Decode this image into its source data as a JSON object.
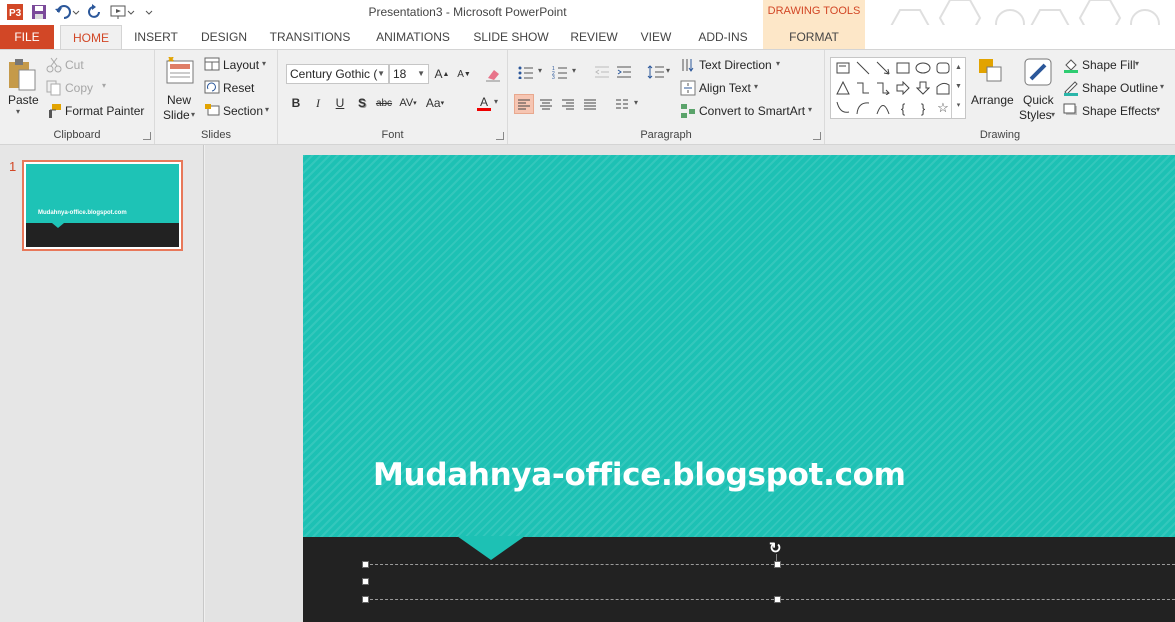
{
  "window": {
    "title": "Presentation3 - Microsoft PowerPoint"
  },
  "contextual": {
    "title": "DRAWING TOOLS",
    "tab": "FORMAT"
  },
  "tabs": [
    "FILE",
    "HOME",
    "INSERT",
    "DESIGN",
    "TRANSITIONS",
    "ANIMATIONS",
    "SLIDE SHOW",
    "REVIEW",
    "VIEW",
    "ADD-INS"
  ],
  "clipboard": {
    "paste": "Paste",
    "cut": "Cut",
    "copy": "Copy",
    "format_painter": "Format Painter",
    "label": "Clipboard"
  },
  "slides_group": {
    "new_slide_1": "New",
    "new_slide_2": "Slide",
    "layout": "Layout",
    "reset": "Reset",
    "section": "Section",
    "label": "Slides"
  },
  "font": {
    "family": "Century Gothic (",
    "size": "18",
    "label": "Font"
  },
  "paragraph": {
    "text_direction": "Text Direction",
    "align_text": "Align Text",
    "convert_smartart": "Convert to SmartArt",
    "label": "Paragraph"
  },
  "drawing": {
    "arrange": "Arrange",
    "quick_1": "Quick",
    "quick_2": "Styles",
    "shape_fill": "Shape Fill",
    "shape_outline": "Shape Outline",
    "shape_effects": "Shape Effects",
    "label": "Drawing"
  },
  "thumbnail": {
    "number": "1",
    "text": "Mudahnya-office.blogspot.com"
  },
  "slide": {
    "title": "Mudahnya-office.blogspot.com"
  },
  "colors": {
    "accent": "#d24726",
    "teal": "#1dc1b4",
    "dark": "#222222"
  }
}
